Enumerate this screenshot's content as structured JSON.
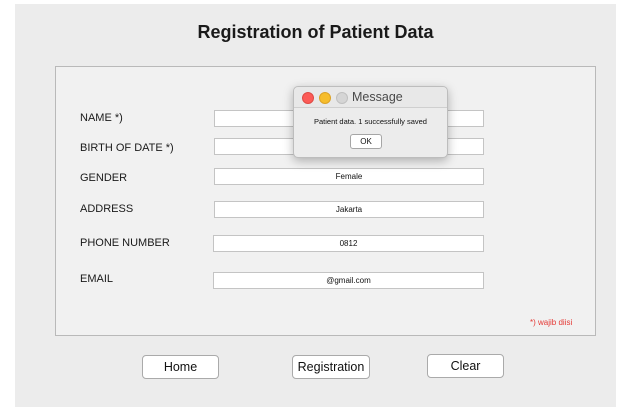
{
  "title": "Registration of Patient Data",
  "form": {
    "fields": [
      {
        "label": "NAME *)",
        "value": ""
      },
      {
        "label": "BIRTH OF DATE *)",
        "value": ""
      },
      {
        "label": "GENDER",
        "value": "Female"
      },
      {
        "label": "ADDRESS",
        "value": "Jakarta"
      },
      {
        "label": "PHONE NUMBER",
        "value": "0812"
      },
      {
        "label": "EMAIL",
        "value": "@gmail.com"
      }
    ],
    "required_note": "*) wajib diisi",
    "required_note_color": "#e53935"
  },
  "buttons": {
    "home": "Home",
    "registration": "Registration",
    "clear": "Clear"
  },
  "dialog": {
    "title": "Message",
    "message": "Patient data. 1 successfully saved",
    "ok": "OK",
    "traffic_light_colors": [
      "#fc5b57",
      "#f6bd2c",
      "#d5d5d5"
    ]
  }
}
